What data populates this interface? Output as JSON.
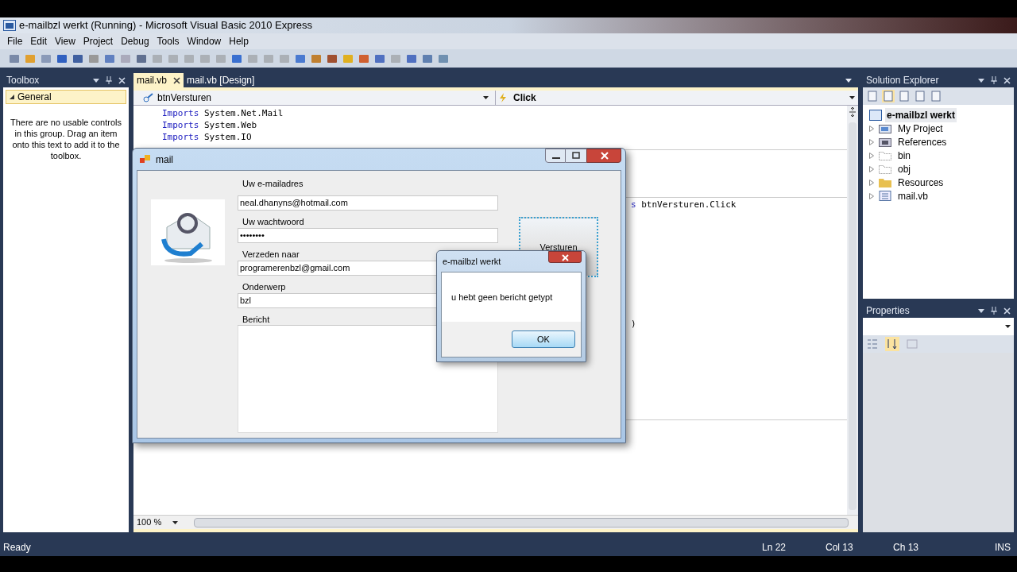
{
  "window": {
    "title": "e-mailbzl werkt (Running) - Microsoft Visual Basic 2010 Express"
  },
  "menu": [
    "File",
    "Edit",
    "View",
    "Project",
    "Debug",
    "Tools",
    "Window",
    "Help"
  ],
  "toolbox": {
    "title": "Toolbox",
    "group": "General",
    "message": "There are no usable controls in this group. Drag an item onto this text to add it to the toolbox."
  },
  "editor": {
    "tabs": [
      {
        "label": "mail.vb",
        "selected": true
      },
      {
        "label": "mail.vb [Design]",
        "selected": false
      }
    ],
    "object_dropdown": "btnVersturen",
    "event_dropdown": "Click",
    "code_lines": [
      {
        "keyword": "Imports",
        "text": " System.Net.Mail"
      },
      {
        "keyword": "Imports",
        "text": " System.Web"
      },
      {
        "keyword": "Imports",
        "text": " System.IO"
      }
    ],
    "partial_line": {
      "keyword": "s",
      "text": " btnVersturen.Click"
    },
    "partial_paren": ")",
    "zoom": "100 %"
  },
  "solution_explorer": {
    "title": "Solution Explorer",
    "root": {
      "label": "e-mailbzl werkt",
      "selected": true
    },
    "items": [
      {
        "label": "My Project",
        "kind": "project",
        "selected": false
      },
      {
        "label": "References",
        "kind": "references",
        "selected": false
      },
      {
        "label": "bin",
        "kind": "hidden",
        "selected": false
      },
      {
        "label": "obj",
        "kind": "hidden",
        "selected": false
      },
      {
        "label": "Resources",
        "kind": "folder",
        "selected": false
      },
      {
        "label": "mail.vb",
        "kind": "file",
        "selected": false
      }
    ]
  },
  "properties": {
    "title": "Properties"
  },
  "mail_form": {
    "title": "mail",
    "fields": [
      {
        "label": "Uw e-mailadres",
        "value": "neal.dhanyns@hotmail.com"
      },
      {
        "label": "Uw wachtwoord",
        "value": "••••••••"
      },
      {
        "label": "Verzeden naar",
        "value": "programerenbzl@gmail.com"
      },
      {
        "label": "Onderwerp",
        "value": "bzl"
      }
    ],
    "message_label": "Bericht",
    "send_button": "Versturen"
  },
  "message_box": {
    "title": "e-mailbzl werkt",
    "text": "u hebt geen bericht getypt",
    "button": "OK"
  },
  "status_bar": {
    "state": "Ready",
    "line": "Ln 22",
    "column": "Col 13",
    "char": "Ch 13",
    "mode": "INS"
  }
}
